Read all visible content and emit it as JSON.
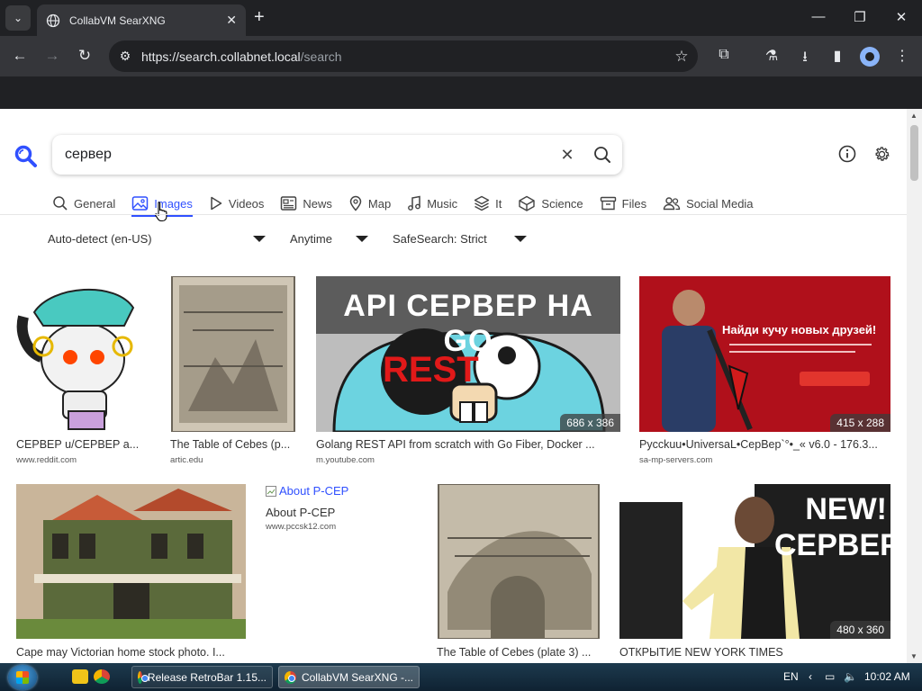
{
  "browser": {
    "tab_title": "CollabVM SearXNG",
    "url_host": "https://search.collabnet.local",
    "url_path": "/search"
  },
  "search": {
    "query": "сервер",
    "categories": [
      {
        "label": "General",
        "icon": "search-icon"
      },
      {
        "label": "Images",
        "icon": "image-icon",
        "active": true
      },
      {
        "label": "Videos",
        "icon": "play-icon"
      },
      {
        "label": "News",
        "icon": "newspaper-icon"
      },
      {
        "label": "Map",
        "icon": "map-pin-icon"
      },
      {
        "label": "Music",
        "icon": "music-note-icon"
      },
      {
        "label": "It",
        "icon": "layers-icon"
      },
      {
        "label": "Science",
        "icon": "cube-icon"
      },
      {
        "label": "Files",
        "icon": "archive-icon"
      },
      {
        "label": "Social Media",
        "icon": "people-icon"
      }
    ],
    "filters": {
      "language": "Auto-detect (en-US)",
      "time": "Anytime",
      "safesearch": "SafeSearch: Strict"
    }
  },
  "results": [
    {
      "caption": "СЕРВЕР u/СЕРВЕР a...",
      "source": "www.reddit.com",
      "dims": ""
    },
    {
      "caption": "The Table of Cebes (p...",
      "source": "artic.edu",
      "dims": ""
    },
    {
      "caption": "Golang REST API from scratch with Go Fiber, Docker ...",
      "source": "m.youtube.com",
      "dims": "686 x 386",
      "overlay_title": "API СЕРВЕР НА GO",
      "overlay_badge": "REST"
    },
    {
      "caption": "Pycckuu•UniversaL•СерВер`°•_« v6.0 - 176.3...",
      "source": "sa-mp-servers.com",
      "dims": "415 x 288",
      "overlay_title": "Найди кучу новых друзей!"
    },
    {
      "caption": "Cape may Victorian home stock photo. I...",
      "source": "",
      "dims": ""
    },
    {
      "caption": "About P-CEP",
      "source": "www.pccsk12.com",
      "dims": "",
      "alt": "About P-CEP"
    },
    {
      "caption": "The Table of Cebes (plate 3) ...",
      "source": "",
      "dims": ""
    },
    {
      "caption": "ОТКРЫТИЕ NEW YORK TIMES",
      "source": "",
      "dims": "480 x 360",
      "overlay_title": "NEW! СЕРВЕР"
    }
  ],
  "taskbar": {
    "tasks": [
      "Release RetroBar 1.15...",
      "CollabVM SearXNG -..."
    ],
    "language": "EN",
    "clock": "10:02 AM"
  },
  "colors": {
    "accent": "#3050ff",
    "chrome_bg": "#202124",
    "toolbar_bg": "#35363a"
  }
}
